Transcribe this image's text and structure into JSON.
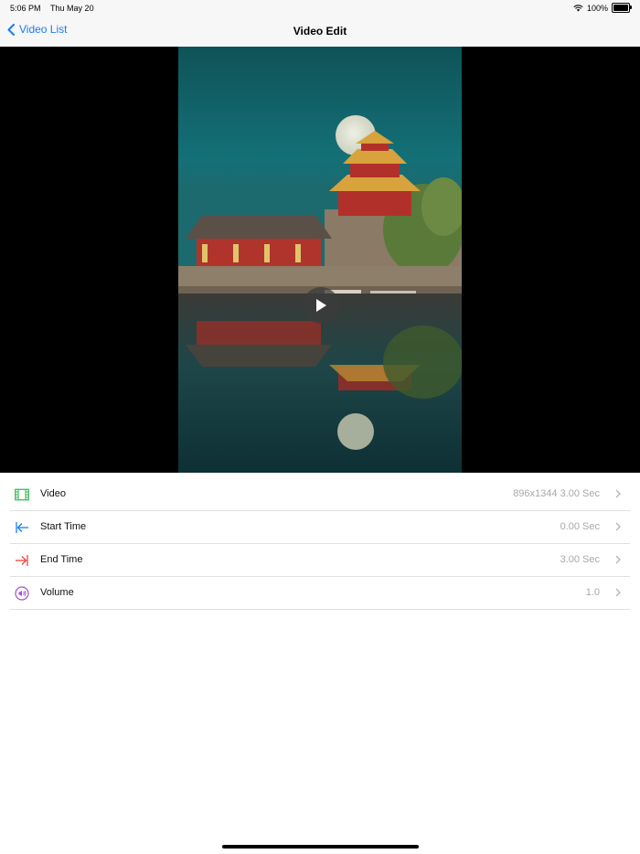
{
  "status_bar": {
    "time": "5:06 PM",
    "date": "Thu May 20",
    "battery": "100%",
    "wifi_icon": "wifi-icon",
    "battery_icon": "battery-icon"
  },
  "nav": {
    "back_label": "Video List",
    "title": "Video Edit",
    "back_icon": "chevron-left-icon"
  },
  "video": {
    "play_icon": "play-icon"
  },
  "settings": [
    {
      "label": "Video",
      "value": "896x1344 3.00 Sec",
      "icon": "film-icon",
      "color": "#2db84d"
    },
    {
      "label": "Start Time",
      "value": "0.00 Sec",
      "icon": "arrow-to-start-icon",
      "color": "#1a7cf0"
    },
    {
      "label": "End Time",
      "value": "3.00 Sec",
      "icon": "arrow-to-end-icon",
      "color": "#e8453c"
    },
    {
      "label": "Volume",
      "value": "1.0",
      "icon": "speaker-icon",
      "color": "#a64fd6"
    }
  ],
  "colors": {
    "accent": "#1a7cf0",
    "secondary_text": "#a8a8a8"
  }
}
